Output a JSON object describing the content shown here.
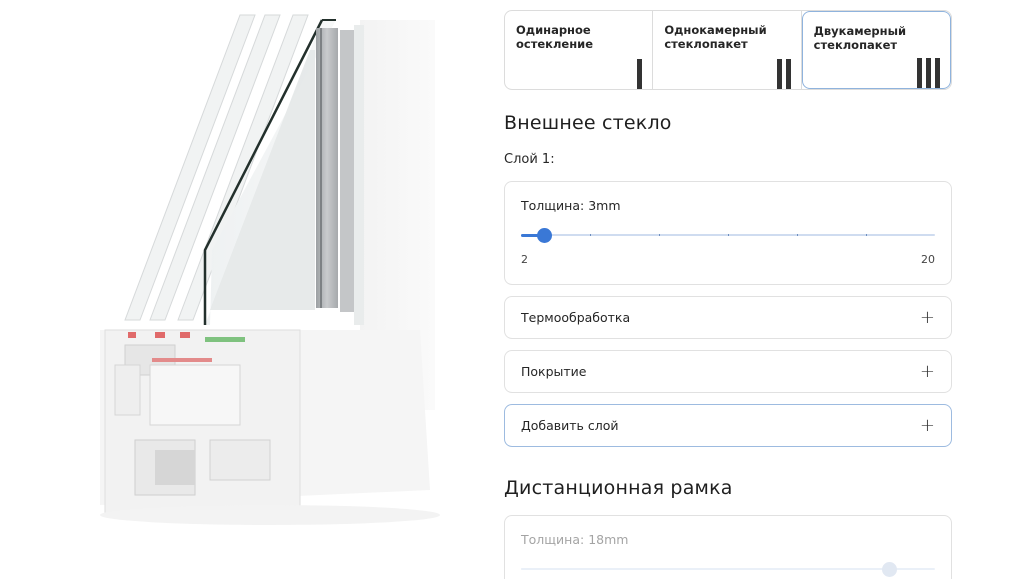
{
  "glazing_types": [
    {
      "label": "Одинарное остекление",
      "bars": 1,
      "active": false
    },
    {
      "label": "Однокамерный стеклопакет",
      "bars": 2,
      "active": false
    },
    {
      "label": "Двукамерный стеклопакет",
      "bars": 3,
      "active": true
    }
  ],
  "outer_glass": {
    "title": "Внешнее стекло",
    "layer_label": "Слой 1:",
    "thickness_label": "Толщина: 3mm",
    "thickness": {
      "value": 3,
      "min": 2,
      "max": 20,
      "min_label": "2",
      "max_label": "20"
    },
    "heat_treatment_label": "Термообработка",
    "coating_label": "Покрытие",
    "add_layer_label": "Добавить слой"
  },
  "spacer_frame": {
    "title": "Дистанционная рамка",
    "thickness_label": "Толщина: 18mm",
    "thickness": {
      "value": 18,
      "min": 2,
      "max": 20
    }
  },
  "icons": {
    "expand": "plus-icon"
  },
  "colors": {
    "accent": "#3a78d6",
    "active_border": "#8fb3dd"
  }
}
